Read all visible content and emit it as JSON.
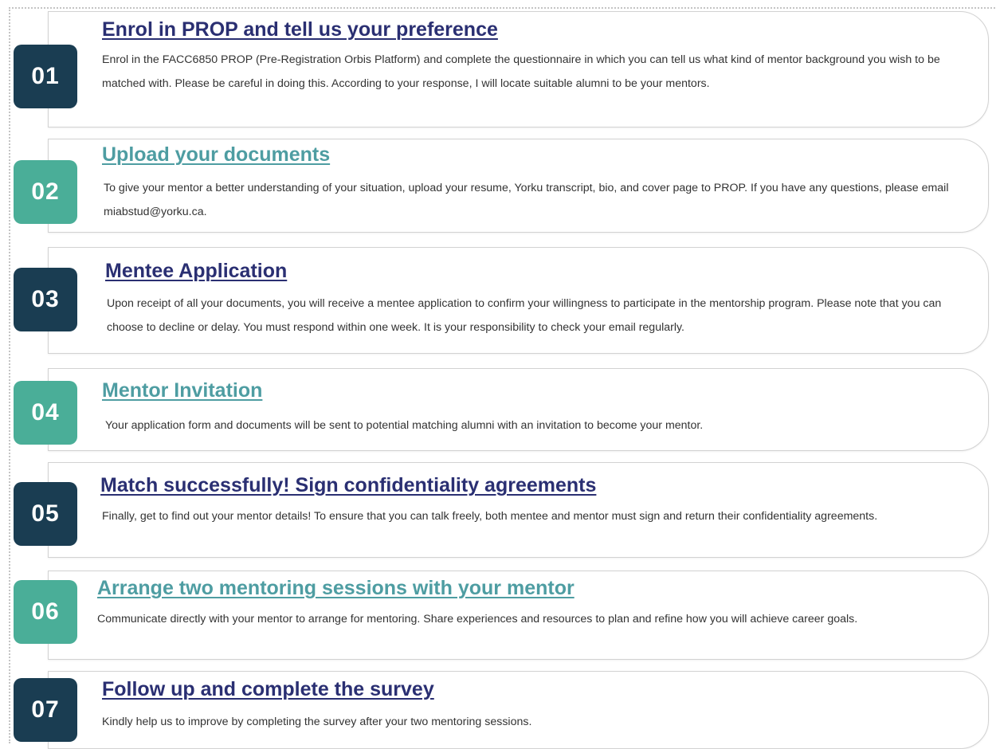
{
  "steps": [
    {
      "number": "01",
      "title": "Enrol in PROP and tell us your preference",
      "description": "Enrol in the FACC6850 PROP (Pre-Registration Orbis Platform) and complete the questionnaire in which you can tell us what kind of mentor background you wish to be matched with. Please be careful in doing this. According to your response, I will locate suitable alumni to be your mentors."
    },
    {
      "number": "02",
      "title": "Upload your documents",
      "description": "To give your mentor a better understanding of your situation, upload your resume, Yorku transcript, bio, and cover page to PROP. If you have any questions, please email miabstud@yorku.ca."
    },
    {
      "number": "03",
      "title": "Mentee Application",
      "description": "Upon receipt of all your documents, you will receive a mentee application to confirm your willingness to participate in the mentorship program. Please note that you can choose to decline or delay. You must respond within one week. It is your responsibility to check your email regularly."
    },
    {
      "number": "04",
      "title": "Mentor Invitation",
      "description": "Your application form and documents will be sent to potential matching alumni with an invitation to become your mentor."
    },
    {
      "number": "05",
      "title": "Match successfully! Sign confidentiality agreements",
      "description": "Finally, get to find out your mentor details! To ensure that you can talk freely, both mentee and mentor must sign and return their confidentiality agreements."
    },
    {
      "number": "06",
      "title": "Arrange two mentoring sessions with your mentor",
      "description": "Communicate directly with your mentor to arrange for mentoring. Share experiences and resources to plan and refine how you will achieve career goals."
    },
    {
      "number": "07",
      "title": "Follow up and complete the survey",
      "description": "Kindly help us to improve by completing the survey after your two mentoring sessions."
    }
  ],
  "colors": {
    "dark_badge": "#1a3d52",
    "teal_badge": "#4aae98",
    "dark_title": "#2a2f72",
    "teal_title": "#4e9da2",
    "body_text": "#333333"
  }
}
